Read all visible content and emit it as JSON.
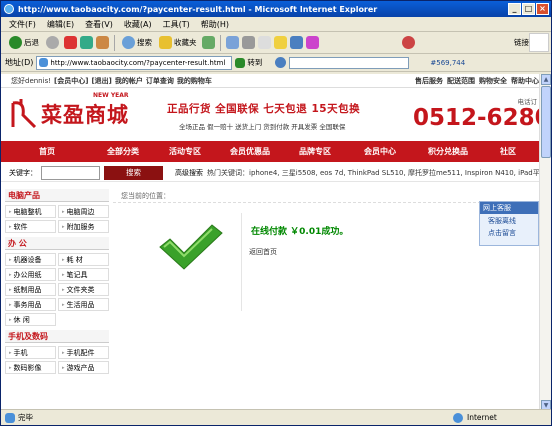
{
  "window": {
    "title": "http://www.taobaocity.com/?paycenter-result.html - Microsoft Internet Explorer",
    "min": "_",
    "max": "□",
    "close": "×"
  },
  "menu": [
    "文件(F)",
    "编辑(E)",
    "查看(V)",
    "收藏(A)",
    "工具(T)",
    "帮助(H)"
  ],
  "toolbar": {
    "back": "后退",
    "search": "搜索",
    "favorites": "收藏夹",
    "links": "链接"
  },
  "address": {
    "label": "地址(D)",
    "url": "http://www.taobaocity.com/?paycenter-result.html",
    "go": "转到",
    "counter": "#569,744"
  },
  "topnav": {
    "greeting": "您好dennis!",
    "links": [
      "[会员中心]",
      "[退出]",
      "我的帐户",
      "订单查询",
      "我的购物车"
    ],
    "right": [
      "售后服务",
      "配送范围",
      "购物安全",
      "帮助中心"
    ]
  },
  "header": {
    "logo_text": "菜盈商城",
    "new_year": "NEW YEAR",
    "slogan": "正品行货  全国联保  七天包退  15天包换",
    "slogan2": "全场正品 假一赔十 送货上门 货到付款 开具发票 全国联保",
    "phone_label": "电话订",
    "phone": "0512-6280"
  },
  "nav": [
    "首页",
    "全部分类",
    "活动专区",
    "会员优惠品",
    "品牌专区",
    "会员中心",
    "积分兑换品",
    "社区"
  ],
  "search": {
    "label": "关键字：",
    "button": "搜索",
    "advanced": "高级搜索",
    "hot": "热门关键词：iphone4, 三星i5508, eos 7d, ThinkPad SL510, 摩托罗拉me511, Inspiron N410, iPad平板"
  },
  "sidebar": [
    {
      "title": "电脑产品",
      "items": [
        "电脑整机",
        "电脑周边",
        "软件",
        "附加服务"
      ]
    },
    {
      "title": "办 公",
      "items": [
        "机器设备",
        "耗 材",
        "办公用纸",
        "笔记具",
        "纸制用品",
        "文件夹类",
        "事务用品",
        "生活用品",
        "休 闲"
      ]
    },
    {
      "title": "手机及数码",
      "items": [
        "手机",
        "手机配件",
        "数码影像",
        "游戏产品"
      ]
    }
  ],
  "main": {
    "crumb": "您当前的位置：",
    "success": "在线付款 ￥0.01成功。",
    "back_home": "返回首页"
  },
  "chat": {
    "title": "网上客服",
    "items": [
      "客服离线",
      "点击留言"
    ]
  },
  "status": {
    "left": "完毕",
    "zone": "Internet"
  }
}
